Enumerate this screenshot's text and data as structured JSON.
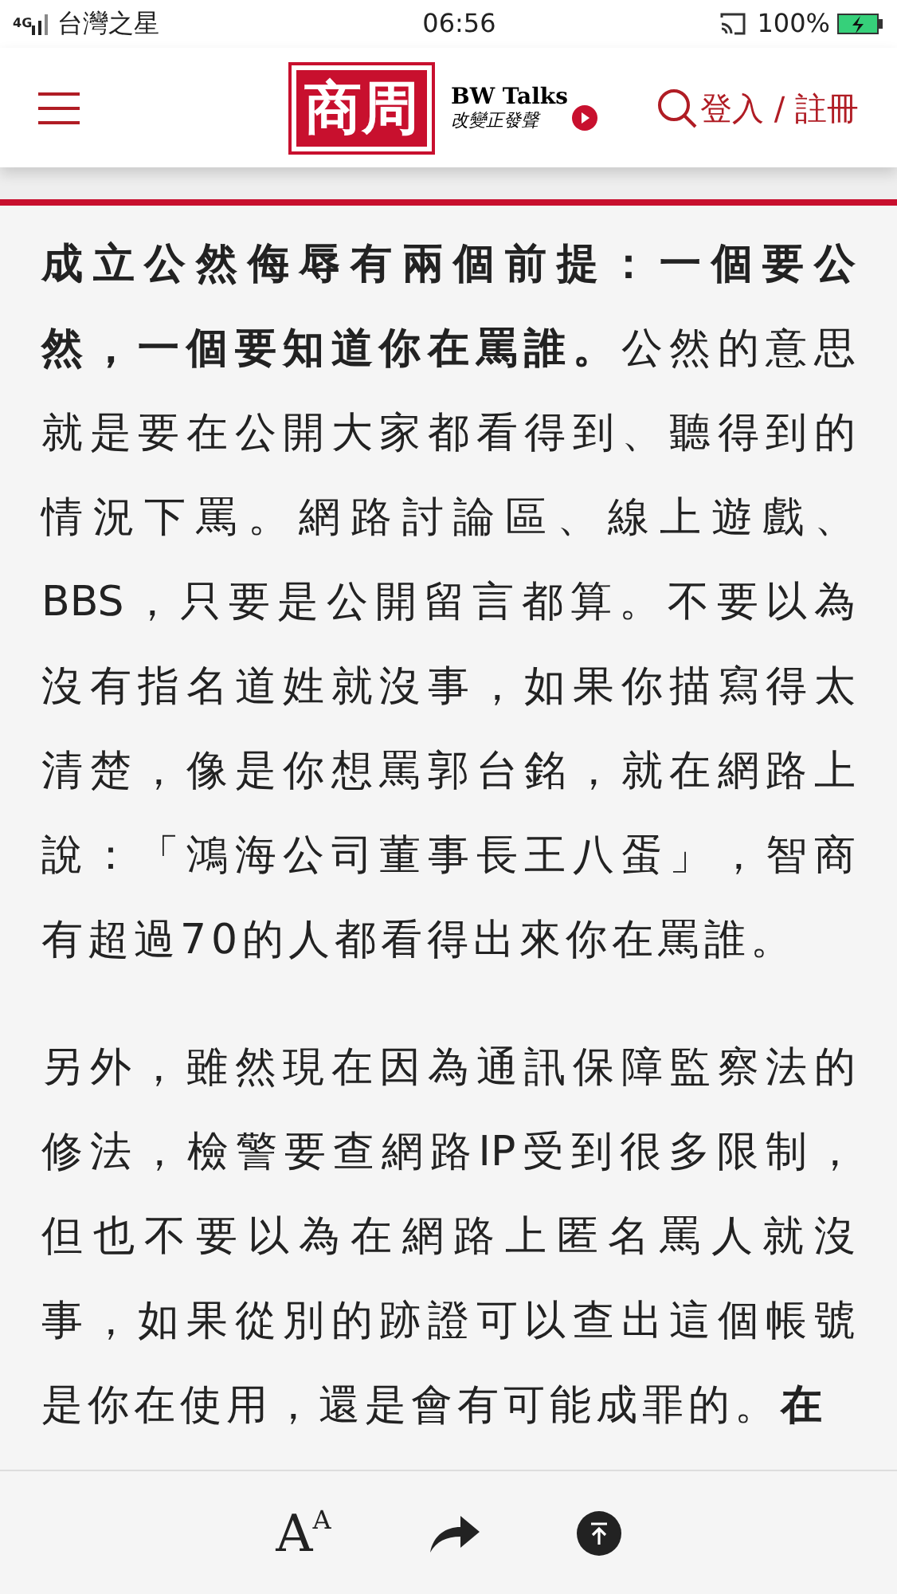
{
  "status_bar": {
    "network": "4G",
    "carrier": "台灣之星",
    "time": "06:56",
    "battery": "100%",
    "charging": true
  },
  "header": {
    "logo": "商周",
    "logo_sub_title": "BW Talks",
    "logo_sub_slogan": "改變正發聲",
    "login": "登入 / 註冊"
  },
  "article": {
    "paragraphs": [
      [
        "**成立公然侮辱有兩個前提：一個要公**",
        "**然，一個要知道你在罵誰。**公然的意思",
        "就是要在公開大家都看得到、聽得到的",
        "情況下罵。網路討論區、線上遊戲、",
        "BBS，只要是公開留言都算。不要以為",
        "沒有指名道姓就沒事，如果你描寫得太",
        "清楚，像是你想罵郭台銘，就在網路上",
        "說：「鴻海公司董事長王八蛋」，智商",
        "有超過70的人都看得出來你在罵誰。"
      ],
      [
        "另外，雖然現在因為通訊保障監察法的",
        "修法，檢警要查網路IP受到很多限制，",
        "但也不要以為在網路上匿名罵人就沒",
        "事，如果從別的跡證可以查出這個帳號",
        "是你在使用，還是會有可能成罪的。**在**"
      ]
    ]
  },
  "toolbar": {
    "font_size_labels": [
      "A",
      "A"
    ]
  }
}
